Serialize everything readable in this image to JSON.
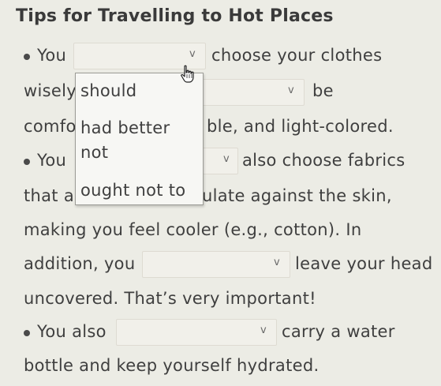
{
  "title": "Tips for Travelling to Hot Places",
  "lines": {
    "l1_prefix": "You",
    "l1_suffix": "choose your clothes",
    "l2_prefix": "wisely",
    "l2_suffix": "be",
    "l3_prefix": "comfo",
    "l3_suffix": "ble, and light-colored.",
    "l4_prefix": "You",
    "l4_suffix": "also choose fabrics",
    "l5_prefix": "that a",
    "l5_suffix": "ulate against the skin,",
    "l6": "making you feel cooler (e.g., cotton). In",
    "l7_prefix": "addition, you",
    "l7_suffix": "leave your head",
    "l8": "uncovered. That’s very important!",
    "l9_prefix": "You also",
    "l9_suffix": "carry a water",
    "l10": "bottle and keep yourself hydrated."
  },
  "dropdowns": {
    "chevron": "v",
    "dd1_value": "",
    "dd2_value": "",
    "dd3_value": "",
    "dd4_value": "",
    "dd5_value": ""
  },
  "menu": {
    "options": [
      "should",
      "had better",
      "not",
      "ought not to"
    ]
  },
  "icons": {
    "cursor": "hand-pointer-icon"
  }
}
